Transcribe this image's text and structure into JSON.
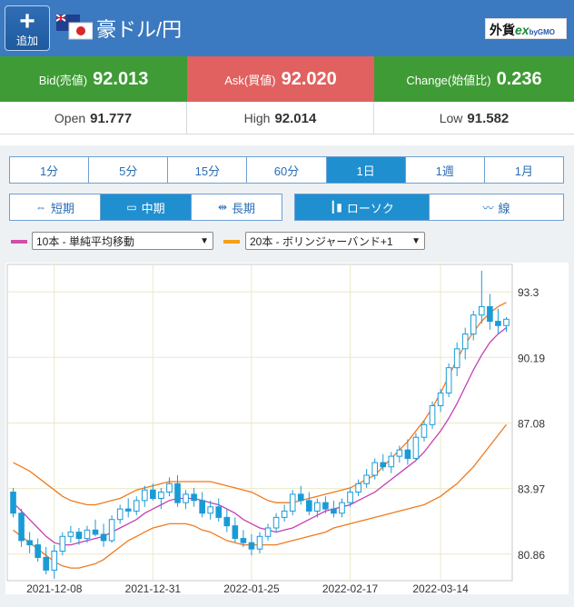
{
  "header": {
    "add_label": "追加",
    "add_icon": "plus-icon",
    "pair_name": "豪ドル/円",
    "logo": {
      "main": "外貨",
      "ex": "ex",
      "by": "byGMO"
    }
  },
  "quote": {
    "bid_label": "Bid(売値)",
    "bid_value": "92.013",
    "ask_label": "Ask(買値)",
    "ask_value": "92.020",
    "change_label": "Change(始値比)",
    "change_value": "0.236"
  },
  "ohl": {
    "open_label": "Open",
    "open_value": "91.777",
    "high_label": "High",
    "high_value": "92.014",
    "low_label": "Low",
    "low_value": "91.582"
  },
  "timeframes": [
    "1分",
    "5分",
    "15分",
    "60分",
    "1日",
    "1週",
    "1月"
  ],
  "timeframe_active": 4,
  "terms": [
    {
      "label": "短期",
      "icon": "short-term-icon"
    },
    {
      "label": "中期",
      "icon": "mid-term-icon"
    },
    {
      "label": "長期",
      "icon": "long-term-icon"
    }
  ],
  "term_active": 1,
  "styles": [
    {
      "label": "ローソク",
      "icon": "candlestick-icon"
    },
    {
      "label": "線",
      "icon": "line-chart-icon"
    }
  ],
  "style_active": 0,
  "indicators": {
    "ma_select": "10本 - 単純平均移動",
    "bb_select": "20本 - ボリンジャーバンド+1",
    "ma_color": "#d14fa8",
    "bb_color": "#f2a11a"
  },
  "colors": {
    "candle": "#1a9bd6",
    "bb_line": "#f07a1e",
    "ma_line": "#c43fb5",
    "active": "#1f8fd0"
  },
  "chart_data": {
    "type": "candlestick",
    "y_ticks": [
      "93.3",
      "90.19",
      "87.08",
      "83.97",
      "80.86"
    ],
    "x_ticks": [
      "2021-12-08",
      "2021-12-31",
      "2022-01-25",
      "2022-02-17",
      "2022-03-14"
    ],
    "ylim": [
      79.6,
      94.6
    ],
    "candles": [
      [
        83.8,
        84.0,
        82.6,
        82.8
      ],
      [
        82.8,
        83.0,
        81.2,
        81.5
      ],
      [
        81.5,
        81.9,
        80.9,
        81.3
      ],
      [
        81.3,
        81.6,
        80.5,
        80.7
      ],
      [
        80.7,
        81.2,
        79.9,
        80.1
      ],
      [
        80.1,
        81.3,
        79.7,
        81.0
      ],
      [
        81.0,
        81.9,
        80.8,
        81.7
      ],
      [
        81.7,
        82.2,
        81.4,
        81.9
      ],
      [
        81.9,
        82.1,
        81.3,
        81.6
      ],
      [
        81.6,
        82.2,
        81.4,
        82.0
      ],
      [
        82.0,
        82.5,
        81.7,
        81.8
      ],
      [
        81.8,
        82.3,
        81.2,
        81.5
      ],
      [
        81.5,
        82.7,
        81.4,
        82.5
      ],
      [
        82.5,
        83.2,
        82.3,
        83.0
      ],
      [
        83.0,
        83.5,
        82.6,
        82.9
      ],
      [
        82.9,
        83.6,
        82.7,
        83.4
      ],
      [
        83.4,
        84.1,
        83.1,
        83.9
      ],
      [
        83.9,
        84.2,
        83.4,
        83.5
      ],
      [
        83.5,
        84.0,
        83.0,
        83.8
      ],
      [
        83.8,
        84.5,
        83.6,
        84.2
      ],
      [
        84.2,
        84.6,
        83.1,
        83.3
      ],
      [
        83.3,
        83.9,
        83.0,
        83.7
      ],
      [
        83.7,
        84.0,
        83.1,
        83.4
      ],
      [
        83.4,
        83.8,
        82.6,
        82.8
      ],
      [
        82.8,
        83.4,
        82.5,
        83.1
      ],
      [
        83.1,
        83.5,
        82.4,
        82.6
      ],
      [
        82.6,
        83.0,
        81.9,
        82.2
      ],
      [
        82.2,
        82.6,
        81.4,
        81.6
      ],
      [
        81.6,
        82.0,
        81.2,
        81.4
      ],
      [
        81.4,
        81.8,
        80.8,
        81.1
      ],
      [
        81.1,
        81.9,
        80.9,
        81.7
      ],
      [
        81.7,
        82.3,
        81.5,
        82.1
      ],
      [
        82.1,
        82.8,
        81.9,
        82.6
      ],
      [
        82.6,
        83.2,
        82.4,
        82.9
      ],
      [
        82.9,
        83.9,
        82.7,
        83.7
      ],
      [
        83.7,
        84.1,
        83.2,
        83.4
      ],
      [
        83.4,
        83.8,
        82.7,
        82.9
      ],
      [
        82.9,
        83.5,
        82.6,
        83.3
      ],
      [
        83.3,
        83.6,
        82.8,
        83.0
      ],
      [
        83.0,
        83.4,
        82.6,
        82.8
      ],
      [
        82.8,
        83.5,
        82.6,
        83.3
      ],
      [
        83.3,
        84.0,
        83.1,
        83.8
      ],
      [
        83.8,
        84.4,
        83.6,
        84.2
      ],
      [
        84.2,
        84.9,
        84.0,
        84.6
      ],
      [
        84.6,
        85.4,
        84.4,
        85.2
      ],
      [
        85.2,
        85.6,
        84.8,
        85.0
      ],
      [
        85.0,
        85.7,
        84.7,
        85.5
      ],
      [
        85.5,
        86.0,
        85.2,
        85.8
      ],
      [
        85.8,
        86.3,
        85.1,
        85.4
      ],
      [
        85.4,
        86.6,
        85.3,
        86.4
      ],
      [
        86.4,
        87.2,
        86.2,
        87.0
      ],
      [
        87.0,
        88.1,
        86.8,
        87.9
      ],
      [
        87.9,
        88.7,
        87.6,
        88.5
      ],
      [
        88.5,
        89.9,
        88.3,
        89.7
      ],
      [
        89.7,
        90.9,
        89.3,
        90.6
      ],
      [
        90.6,
        91.6,
        90.1,
        91.3
      ],
      [
        91.3,
        92.4,
        91.0,
        92.2
      ],
      [
        92.2,
        94.3,
        91.8,
        92.6
      ],
      [
        92.6,
        93.2,
        91.5,
        91.9
      ],
      [
        91.9,
        92.5,
        91.3,
        91.7
      ],
      [
        91.7,
        92.1,
        91.4,
        92.0
      ]
    ],
    "ma10": [
      83.3,
      82.9,
      82.5,
      82.1,
      81.7,
      81.4,
      81.3,
      81.3,
      81.4,
      81.5,
      81.6,
      81.7,
      81.9,
      82.1,
      82.3,
      82.5,
      82.8,
      83.0,
      83.2,
      83.4,
      83.5,
      83.5,
      83.5,
      83.4,
      83.3,
      83.2,
      83.0,
      82.8,
      82.5,
      82.3,
      82.1,
      82.0,
      81.9,
      82.0,
      82.1,
      82.3,
      82.5,
      82.7,
      82.9,
      83.0,
      83.1,
      83.2,
      83.4,
      83.6,
      83.8,
      84.1,
      84.4,
      84.7,
      85.0,
      85.3,
      85.7,
      86.2,
      86.7,
      87.3,
      88.0,
      88.8,
      89.6,
      90.3,
      90.9,
      91.3,
      91.6
    ],
    "bb_upper": [
      85.2,
      85.0,
      84.8,
      84.5,
      84.2,
      83.9,
      83.6,
      83.4,
      83.3,
      83.2,
      83.2,
      83.3,
      83.4,
      83.5,
      83.7,
      83.9,
      84.0,
      84.1,
      84.2,
      84.3,
      84.3,
      84.3,
      84.3,
      84.3,
      84.3,
      84.2,
      84.1,
      84.0,
      83.9,
      83.8,
      83.6,
      83.4,
      83.3,
      83.3,
      83.3,
      83.4,
      83.5,
      83.6,
      83.7,
      83.8,
      83.9,
      84.0,
      84.2,
      84.4,
      84.6,
      85.0,
      85.4,
      85.8,
      86.2,
      86.7,
      87.2,
      87.8,
      88.5,
      89.3,
      90.1,
      90.8,
      91.4,
      91.9,
      92.3,
      92.6,
      92.8
    ],
    "bb_lower": [
      82.0,
      81.7,
      81.4,
      81.1,
      80.8,
      80.5,
      80.3,
      80.2,
      80.2,
      80.3,
      80.4,
      80.6,
      80.9,
      81.2,
      81.5,
      81.7,
      81.9,
      82.1,
      82.2,
      82.3,
      82.3,
      82.3,
      82.2,
      82.0,
      81.9,
      81.7,
      81.5,
      81.4,
      81.3,
      81.3,
      81.3,
      81.3,
      81.3,
      81.4,
      81.5,
      81.6,
      81.7,
      81.8,
      81.9,
      82.1,
      82.2,
      82.3,
      82.4,
      82.5,
      82.6,
      82.7,
      82.8,
      82.9,
      83.0,
      83.1,
      83.2,
      83.4,
      83.6,
      83.9,
      84.2,
      84.6,
      85.0,
      85.5,
      86.0,
      86.5,
      87.0
    ]
  }
}
